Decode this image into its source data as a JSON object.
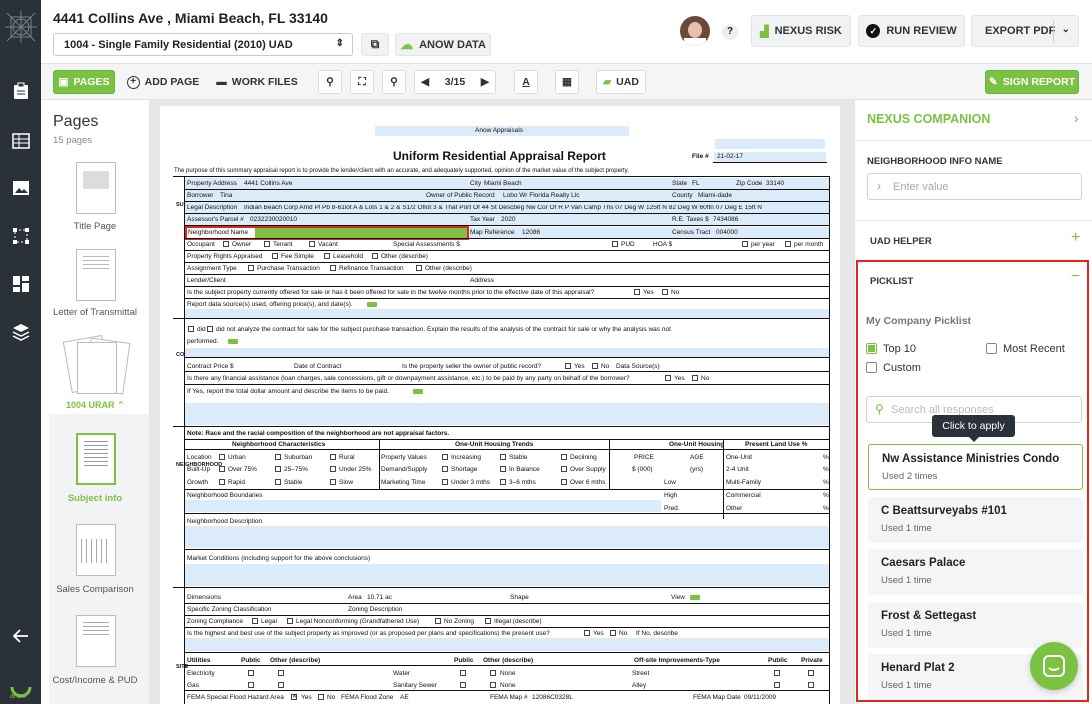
{
  "header": {
    "address": "4441 Collins Ave , Miami Beach, FL 33140",
    "form_select": "1004 - Single Family Residential (2010) UAD",
    "anow_data": "ANOW DATA",
    "help": "?",
    "nexus_risk": "NEXUS RISK",
    "run_review": "RUN REVIEW",
    "export_pdf": "EXPORT PDF"
  },
  "toolbar": {
    "pages": "PAGES",
    "add_page": "ADD PAGE",
    "work_files": "WORK FILES",
    "page_count": "3/15",
    "uad": "UAD",
    "sign_report": "SIGN REPORT"
  },
  "pages_panel": {
    "title": "Pages",
    "count": "15 pages",
    "items": [
      "Title Page",
      "Letter of Transmittal",
      "1004 URAR",
      "Subject info",
      "Sales Comparison",
      "Cost/Income & PUD"
    ]
  },
  "doc": {
    "company": "Anow Appraisals",
    "title": "Uniform Residential Appraisal Report",
    "file_label": "File #",
    "file_no": "21-02-17",
    "purpose": "The purpose of this summary appraisal report is to provide the lender/client with an accurate, and adequately supported, opinion of the market value of the subject property.",
    "subject": {
      "address_label": "Property Address",
      "address": "4441 Collins Ave",
      "city_label": "City",
      "city": "Miami Beach",
      "state_label": "State",
      "state": "FL",
      "zip_label": "Zip Code",
      "zip": "33140",
      "borrower_label": "Borrower",
      "borrower": "Tina",
      "owner_label": "Owner of Public Record",
      "owner": "Lobo Wr Florida Realty Llc",
      "county_label": "County",
      "county": "Miami-dade",
      "legal_label": "Legal Description",
      "legal": "Indian Beach Corp Amd Pl Pb 8-61lot A & Lots 1 & 2 & S1/2 Oflot 3 & That Port Of 44 St Descbeg Nw Cor Of R P Van Camp Ths 07 Deg W 125ft N 82 Deg W 60ftn 07 Deg E 15ft N",
      "parcel_label": "Assessor's Parcel #",
      "parcel": "0232230020010",
      "taxyear_label": "Tax Year",
      "taxyear": "2020",
      "retax_label": "R.E. Taxes $",
      "retax": "7434086",
      "neigh_label": "Neighborhood Name",
      "mapref_label": "Map Reference",
      "mapref": "12086",
      "census_label": "Census Tract",
      "census": "004000",
      "occupant": "Occupant",
      "owner_cb": "Owner",
      "tenant": "Tenant",
      "vacant": "Vacant",
      "special": "Special Assessments $",
      "pud": "PUD",
      "hoa": "HOA $",
      "per_year": "per year",
      "per_month": "per month",
      "rights": "Property Rights Appraised",
      "fee": "Fee Simple",
      "leasehold": "Leasehold",
      "other_desc": "Other (describe)",
      "assign": "Assignment Type",
      "purchase": "Purchase Transaction",
      "refi": "Refinance Transaction",
      "lender": "Lender/Client",
      "address2": "Address",
      "offered": "Is the subject property currently offered for sale or has it been offered for sale in the twelve months prior to the effective date of this appraisal?",
      "yes": "Yes",
      "no": "No",
      "report_src": "Report data source(s) used, offering price(s), and date(s)."
    },
    "contract": {
      "did": "did",
      "did_not": "did not analyze the contract for sale for the subject purchase transaction. Explain the results of the analysis of the contract for sale or why the analysis was not",
      "performed": "performed.",
      "price": "Contract Price $",
      "date": "Date of Contract",
      "seller": "Is the property seller the owner of public record?",
      "data_src": "Data Source(s)",
      "assist": "Is there any financial assistance (loan charges, sale concessions, gift or downpayment assistance, etc.) to be paid by any party on behalf of the borrower?",
      "report_total": "If Yes, report the total dollar amount and describe the items to be paid."
    },
    "neighborhood": {
      "note": "Note: Race and the racial composition of the neighborhood are not appraisal factors.",
      "char": "Neighborhood Characteristics",
      "trends": "One-Unit Housing Trends",
      "housing": "One-Unit Housing",
      "land": "Present Land Use %",
      "location": "Location",
      "urban": "Urban",
      "suburban": "Suburban",
      "rural": "Rural",
      "prop_values": "Property Values",
      "increasing": "Increasing",
      "stable": "Stable",
      "declining": "Declining",
      "price": "PRICE",
      "age": "AGE",
      "one_unit": "One-Unit",
      "pct": "%",
      "built": "Built-Up",
      "over75": "Over 75%",
      "25_75": "25–75%",
      "under25": "Under 25%",
      "demand": "Demand/Supply",
      "shortage": "Shortage",
      "balance": "In Balance",
      "over_supply": "Over Supply",
      "price_unit": "$ (000)",
      "yrs": "(yrs)",
      "two_four": "2-4 Unit",
      "growth": "Growth",
      "rapid": "Rapid",
      "slow": "Slow",
      "marketing": "Marketing Time",
      "under3": "Under 3 mths",
      "3_6": "3–6 mths",
      "over6": "Over 6 mths",
      "low": "Low",
      "multi": "Multi-Family",
      "boundaries": "Neighborhood Boundaries",
      "high": "High",
      "commercial": "Commercial",
      "pred": "Pred.",
      "other": "Other",
      "description": "Neighborhood Description",
      "market": "Market Conditions (including support for the above conclusions)"
    },
    "site": {
      "dimensions": "Dimensions",
      "area_label": "Area",
      "area": "10.71 ac",
      "shape": "Shape",
      "view": "View",
      "zoning_class": "Specific Zoning Classification",
      "zoning_desc": "Zoning Description",
      "zoning_comp": "Zoning Compliance",
      "legal": "Legal",
      "legal_nonconf": "Legal Nonconforming (Grandfathered Use)",
      "no_zoning": "No Zoning",
      "illegal": "Illegal (describe)",
      "highest": "Is the highest and best use of the subject property as improved (or as proposed per plans and specifications) the present use?",
      "if_no": "If No, describe",
      "utilities": "Utilities",
      "public": "Public",
      "other_d": "Other (describe)",
      "offsite": "Off-site Improvements-Type",
      "private": "Private",
      "electricity": "Electricity",
      "water": "Water",
      "none": "None",
      "street": "Street",
      "gas": "Gas",
      "sewer": "Sanitary Sewer",
      "alley": "Alley",
      "fema": "FEMA Special Flood Hazard Area",
      "fema_zone": "FEMA Flood Zone",
      "fema_zone_v": "AE",
      "fema_map": "FEMA Map #",
      "fema_map_v": "12086C0328L",
      "fema_date": "FEMA Map Date",
      "fema_date_v": "09/11/2009"
    },
    "side_labels": {
      "subject": "SUBJECT",
      "contract": "CONTRACT",
      "neighborhood": "NEIGHBORHOOD",
      "site": "SITE"
    }
  },
  "sidebar": {
    "title": "NEXUS COMPANION",
    "field_label": "NEIGHBORHOOD INFO NAME",
    "field_placeholder": "Enter value",
    "uad_helper": "UAD HELPER",
    "picklist": "PICKLIST",
    "my_company": "My Company Picklist",
    "opt_top10": "Top 10",
    "opt_recent": "Most Recent",
    "opt_custom": "Custom",
    "search_placeholder": "Search all responses",
    "tooltip": "Click to apply",
    "items": [
      {
        "name": "Nw Assistance Ministries Condo",
        "used": "Used 2 times"
      },
      {
        "name": "C Beattsurveyabs #101",
        "used": "Used 1 time"
      },
      {
        "name": "Caesars Palace",
        "used": "Used 1 time"
      },
      {
        "name": "Frost & Settegast",
        "used": "Used 1 time"
      },
      {
        "name": "Henard Plat 2",
        "used": "Used 1 time"
      }
    ]
  },
  "colors": {
    "accent_green": "#7cc242",
    "rail": "#2b3138",
    "highlight_red": "#e0271f",
    "field_blue": "#dcebf9",
    "companion_green": "#7cc242"
  }
}
